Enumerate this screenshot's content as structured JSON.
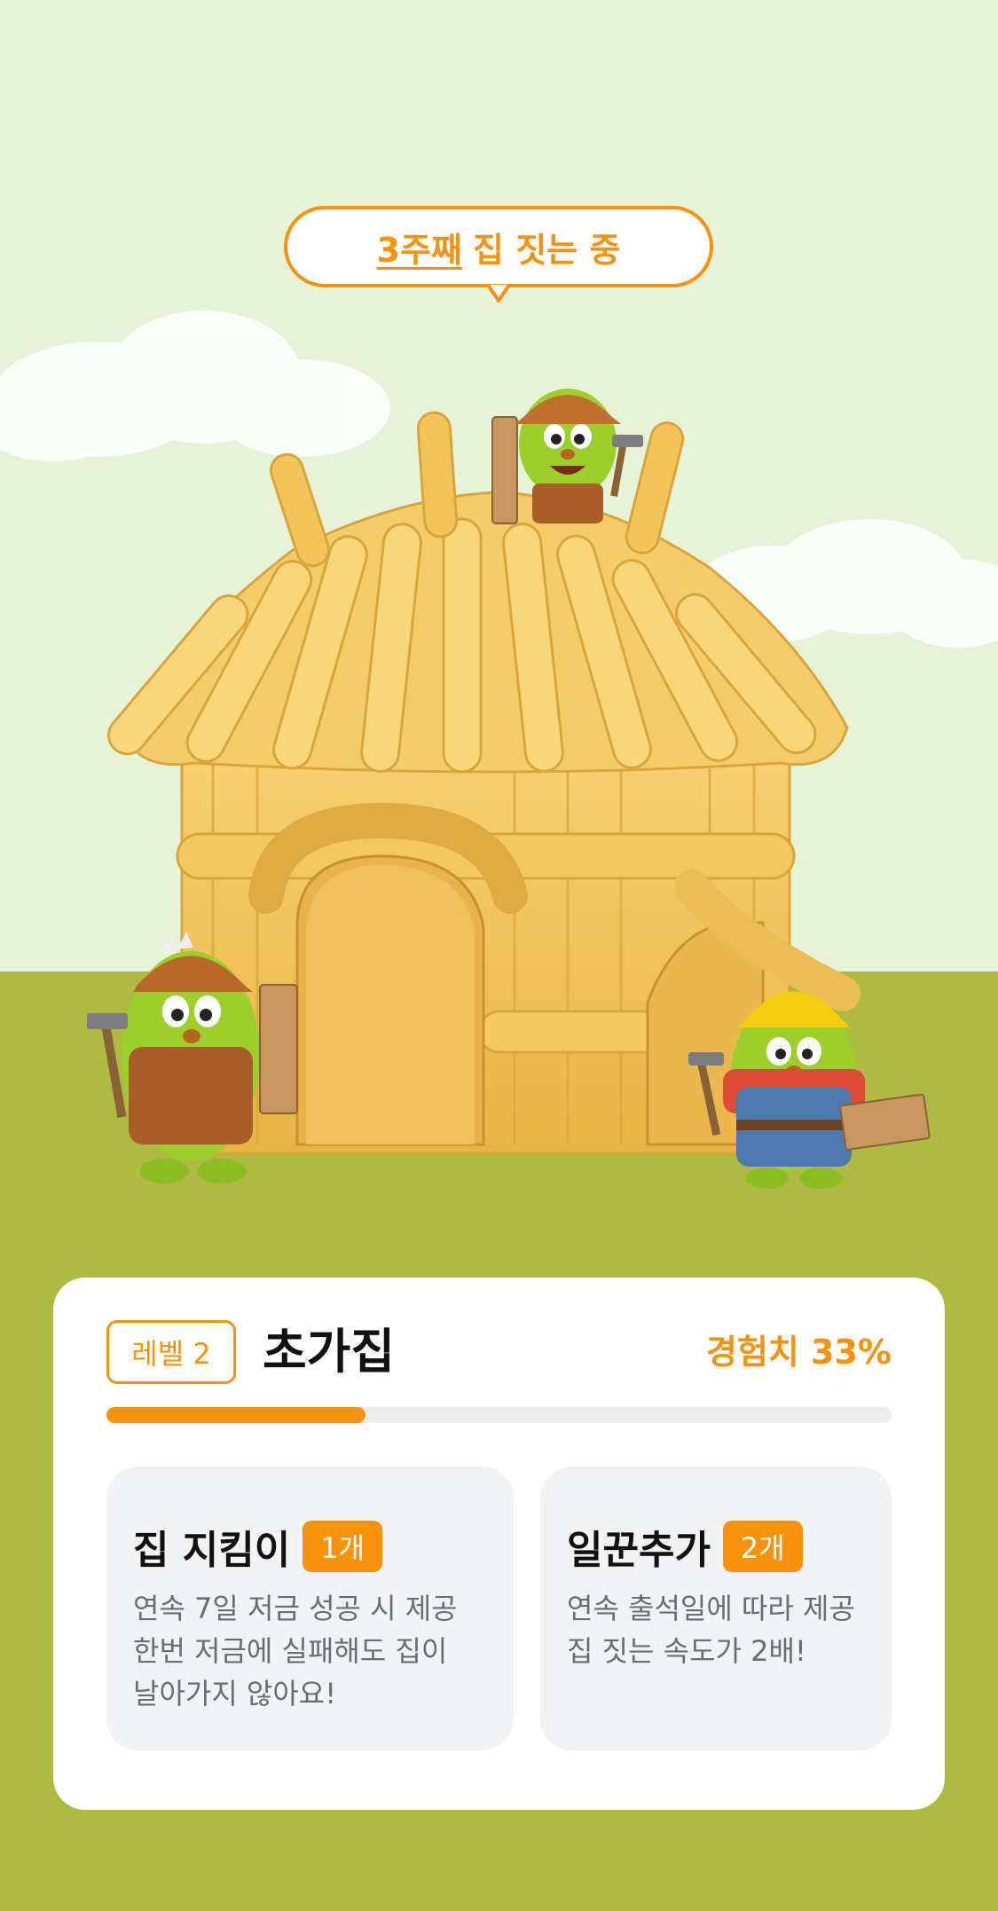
{
  "banner": {
    "highlight": "3주째",
    "rest": "집 짓는 중"
  },
  "card": {
    "level_label": "레벨 2",
    "house_name": "초가집",
    "exp_label": "경험치 33%",
    "exp_progress": 0.33,
    "perks": [
      {
        "title": "집 지킴이",
        "count": "1개",
        "lines": [
          "연속 7일 저금 성공 시 제공",
          "한번 저금에 실패해도 집이",
          "날아가지 않아요!"
        ]
      },
      {
        "title": "일꾼추가",
        "count": "2개",
        "lines": [
          "연속 출석일에 따라 제공",
          "집 짓는 속도가 2배!"
        ]
      }
    ]
  },
  "colors": {
    "accent": "#f6920d",
    "sky": "#e6f3d8",
    "ground": "#afba45",
    "straw": "#f2c55a"
  }
}
